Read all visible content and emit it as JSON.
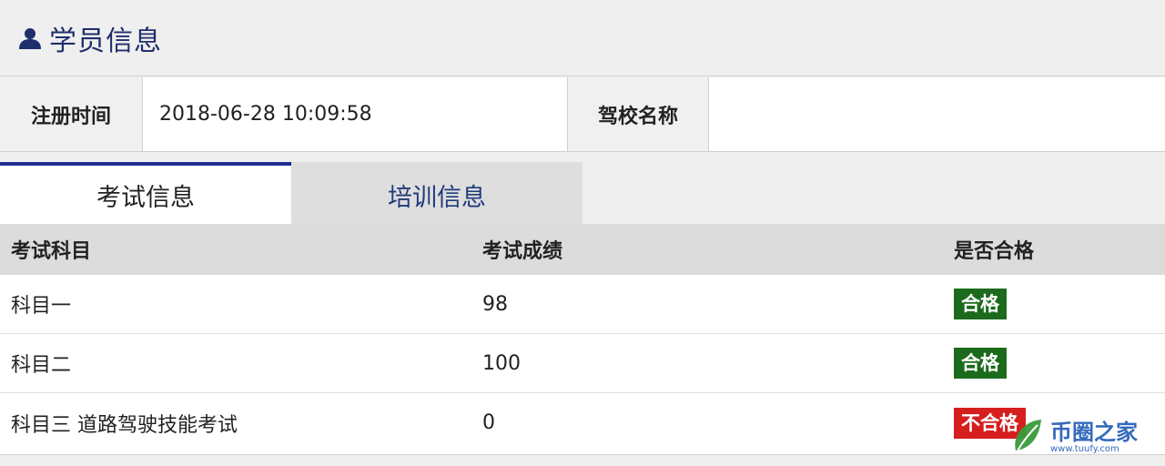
{
  "header": {
    "title": "学员信息",
    "icon": "user-icon"
  },
  "info": {
    "reg_time_label": "注册时间",
    "reg_time_value": "2018-06-28 10:09:58",
    "school_label": "驾校名称",
    "school_value": ""
  },
  "tabs": [
    {
      "label": "考试信息",
      "active": true
    },
    {
      "label": "培训信息",
      "active": false
    }
  ],
  "table": {
    "headers": [
      "考试科目",
      "考试成绩",
      "是否合格"
    ],
    "rows": [
      {
        "subject": "科目一",
        "score": "98",
        "result": "合格",
        "status": "pass"
      },
      {
        "subject": "科目二",
        "score": "100",
        "result": "合格",
        "status": "pass"
      },
      {
        "subject": "科目三 道路驾驶技能考试",
        "score": "0",
        "result": "不合格",
        "status": "fail"
      }
    ]
  },
  "watermark": {
    "main": "币圈之家",
    "sub": "www.tuufy.com"
  },
  "colors": {
    "title": "#1f2f6b",
    "pass": "#1c6b1c",
    "fail": "#d61e1e",
    "tab_accent": "#1f2f8f"
  }
}
